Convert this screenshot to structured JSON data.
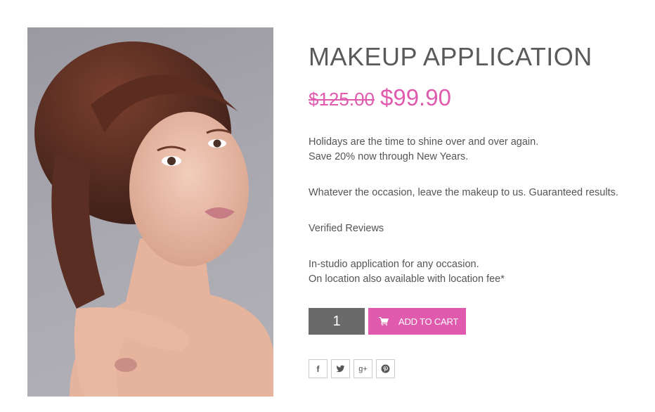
{
  "product": {
    "title": "MAKEUP APPLICATION",
    "old_price": "$125.00",
    "new_price": "$99.90",
    "description": {
      "line1": "Holidays are the time to shine over and over again.",
      "line2": "Save 20% now through New Years.",
      "line3": "Whatever the occasion, leave the makeup to us. Guaranteed results.",
      "line4": "Verified Reviews",
      "line5": "In-studio application for any occasion.",
      "line6": "On location also available with location fee*"
    },
    "quantity": "1",
    "add_to_cart_label": "ADD TO CART",
    "image_alt": "Woman with braided updo and natural makeup"
  },
  "social": {
    "facebook": "f",
    "google_plus": "g+"
  },
  "colors": {
    "accent": "#e05aad",
    "qty_bg": "#6a6a6a",
    "text": "#555555"
  },
  "icons": [
    "cart-icon",
    "facebook-icon",
    "twitter-icon",
    "google-plus-icon",
    "pinterest-icon"
  ]
}
